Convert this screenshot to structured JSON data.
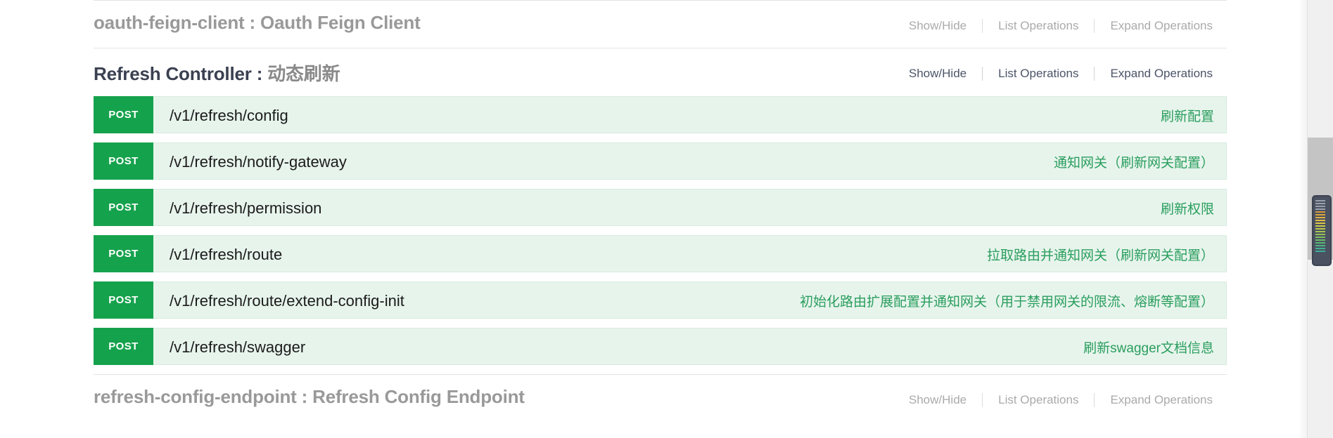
{
  "sections": [
    {
      "tag": "oauth-feign-client",
      "separator": " : ",
      "description": "Oauth Feign Client",
      "links": {
        "show_hide": "Show/Hide",
        "list_operations": "List Operations",
        "expand_operations": "Expand Operations"
      },
      "style": "muted",
      "operations": []
    },
    {
      "tag": "Refresh Controller",
      "separator": " : ",
      "description": "动态刷新",
      "links": {
        "show_hide": "Show/Hide",
        "list_operations": "List Operations",
        "expand_operations": "Expand Operations"
      },
      "style": "dark",
      "operations": [
        {
          "method": "POST",
          "path": "/v1/refresh/config",
          "summary": "刷新配置"
        },
        {
          "method": "POST",
          "path": "/v1/refresh/notify-gateway",
          "summary": "通知网关（刷新网关配置）"
        },
        {
          "method": "POST",
          "path": "/v1/refresh/permission",
          "summary": "刷新权限"
        },
        {
          "method": "POST",
          "path": "/v1/refresh/route",
          "summary": "拉取路由并通知网关（刷新网关配置）"
        },
        {
          "method": "POST",
          "path": "/v1/refresh/route/extend-config-init",
          "summary": "初始化路由扩展配置并通知网关（用于禁用网关的限流、熔断等配置）"
        },
        {
          "method": "POST",
          "path": "/v1/refresh/swagger",
          "summary": "刷新swagger文档信息"
        }
      ]
    },
    {
      "tag": "refresh-config-endpoint",
      "separator": " : ",
      "description": "Refresh Config Endpoint",
      "links": {
        "show_hide": "Show/Hide",
        "list_operations": "List Operations",
        "expand_operations": "Expand Operations"
      },
      "style": "muted",
      "operations": []
    }
  ],
  "colors": {
    "post_badge": "#15a24c",
    "operation_row_background": "#e7f4ec",
    "operation_summary_text": "#2a9e5e",
    "muted_link": "#aaaaaa",
    "dark_link": "#4b5468"
  }
}
